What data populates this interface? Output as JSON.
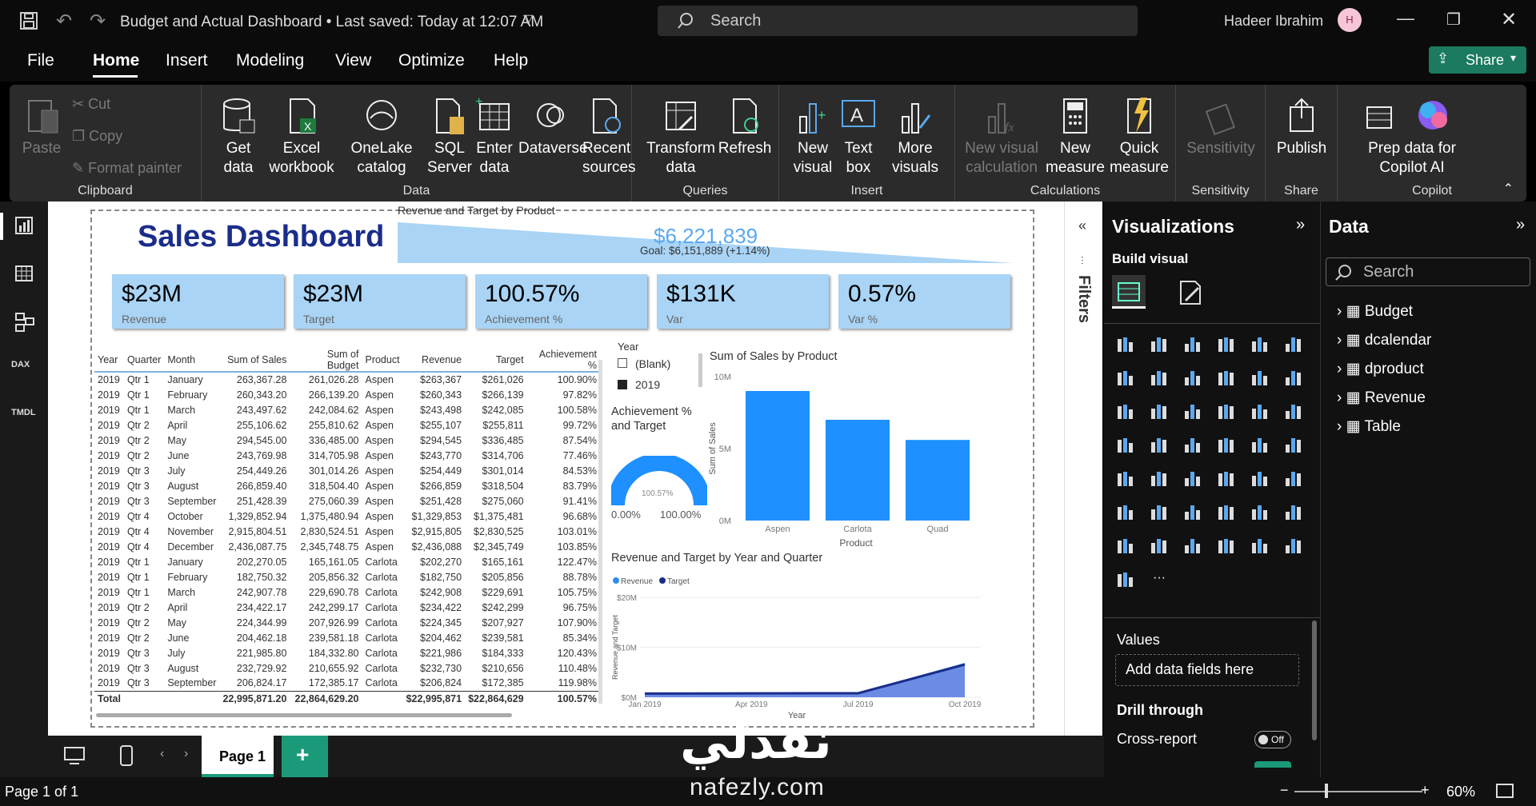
{
  "titlebar": {
    "file_title": "Budget and Actual Dashboard • Last saved: Today at 12:07 AM",
    "search": "Search",
    "user": "Hadeer Ibrahim",
    "avatar": "H"
  },
  "menu": {
    "items": [
      "File",
      "Home",
      "Insert",
      "Modeling",
      "View",
      "Optimize",
      "Help"
    ],
    "active": "Home",
    "share": "Share"
  },
  "ribbon": {
    "clipboard": {
      "paste": "Paste",
      "cut": "Cut",
      "copy": "Copy",
      "format_painter": "Format painter",
      "label": "Clipboard"
    },
    "data": {
      "get_data": "Get data",
      "excel": "Excel workbook",
      "onelake": "OneLake catalog",
      "sql": "SQL Server",
      "enter": "Enter data",
      "dataverse": "Dataverse",
      "recent": "Recent sources",
      "label": "Data"
    },
    "queries": {
      "transform": "Transform data",
      "refresh": "Refresh",
      "label": "Queries"
    },
    "insert": {
      "new_visual": "New visual",
      "text_box": "Text box",
      "more_visuals": "More visuals",
      "label": "Insert"
    },
    "calculations": {
      "new_visual_calc": "New visual calculation",
      "new_measure": "New measure",
      "quick_measure": "Quick measure",
      "label": "Calculations"
    },
    "sensitivity": {
      "btn": "Sensitivity",
      "label": "Sensitivity"
    },
    "share": {
      "publish": "Publish",
      "label": "Share"
    },
    "copilot": {
      "prep": "Prep data for Copilot AI",
      "label": "Copilot"
    }
  },
  "report": {
    "title": "Sales Dashboard",
    "gauge_title": "Revenue and Target by Product",
    "gauge_value": "$6,221,839",
    "gauge_goal": "Goal: $6,151,889 (+1.14%)",
    "kpis": [
      {
        "value": "$23M",
        "label": "Revenue"
      },
      {
        "value": "$23M",
        "label": "Target"
      },
      {
        "value": "100.57%",
        "label": "Achievement %"
      },
      {
        "value": "$131K",
        "label": "Var"
      },
      {
        "value": "0.57%",
        "label": "Var %"
      }
    ],
    "table": {
      "headers": [
        "Year",
        "Quarter",
        "Month",
        "Sum of Sales",
        "Sum of Budget",
        "Product",
        "Revenue",
        "Target",
        "Achievement %"
      ],
      "rows": [
        [
          "2019",
          "Qtr 1",
          "January",
          "263,367.28",
          "261,026.28",
          "Aspen",
          "$263,367",
          "$261,026",
          "100.90%"
        ],
        [
          "2019",
          "Qtr 1",
          "February",
          "260,343.20",
          "266,139.20",
          "Aspen",
          "$260,343",
          "$266,139",
          "97.82%"
        ],
        [
          "2019",
          "Qtr 1",
          "March",
          "243,497.62",
          "242,084.62",
          "Aspen",
          "$243,498",
          "$242,085",
          "100.58%"
        ],
        [
          "2019",
          "Qtr 2",
          "April",
          "255,106.62",
          "255,810.62",
          "Aspen",
          "$255,107",
          "$255,811",
          "99.72%"
        ],
        [
          "2019",
          "Qtr 2",
          "May",
          "294,545.00",
          "336,485.00",
          "Aspen",
          "$294,545",
          "$336,485",
          "87.54%"
        ],
        [
          "2019",
          "Qtr 2",
          "June",
          "243,769.98",
          "314,705.98",
          "Aspen",
          "$243,770",
          "$314,706",
          "77.46%"
        ],
        [
          "2019",
          "Qtr 3",
          "July",
          "254,449.26",
          "301,014.26",
          "Aspen",
          "$254,449",
          "$301,014",
          "84.53%"
        ],
        [
          "2019",
          "Qtr 3",
          "August",
          "266,859.40",
          "318,504.40",
          "Aspen",
          "$266,859",
          "$318,504",
          "83.79%"
        ],
        [
          "2019",
          "Qtr 3",
          "September",
          "251,428.39",
          "275,060.39",
          "Aspen",
          "$251,428",
          "$275,060",
          "91.41%"
        ],
        [
          "2019",
          "Qtr 4",
          "October",
          "1,329,852.94",
          "1,375,480.94",
          "Aspen",
          "$1,329,853",
          "$1,375,481",
          "96.68%"
        ],
        [
          "2019",
          "Qtr 4",
          "November",
          "2,915,804.51",
          "2,830,524.51",
          "Aspen",
          "$2,915,805",
          "$2,830,525",
          "103.01%"
        ],
        [
          "2019",
          "Qtr 4",
          "December",
          "2,436,087.75",
          "2,345,748.75",
          "Aspen",
          "$2,436,088",
          "$2,345,749",
          "103.85%"
        ],
        [
          "2019",
          "Qtr 1",
          "January",
          "202,270.05",
          "165,161.05",
          "Carlota",
          "$202,270",
          "$165,161",
          "122.47%"
        ],
        [
          "2019",
          "Qtr 1",
          "February",
          "182,750.32",
          "205,856.32",
          "Carlota",
          "$182,750",
          "$205,856",
          "88.78%"
        ],
        [
          "2019",
          "Qtr 1",
          "March",
          "242,907.78",
          "229,690.78",
          "Carlota",
          "$242,908",
          "$229,691",
          "105.75%"
        ],
        [
          "2019",
          "Qtr 2",
          "April",
          "234,422.17",
          "242,299.17",
          "Carlota",
          "$234,422",
          "$242,299",
          "96.75%"
        ],
        [
          "2019",
          "Qtr 2",
          "May",
          "224,344.99",
          "207,926.99",
          "Carlota",
          "$224,345",
          "$207,927",
          "107.90%"
        ],
        [
          "2019",
          "Qtr 2",
          "June",
          "204,462.18",
          "239,581.18",
          "Carlota",
          "$204,462",
          "$239,581",
          "85.34%"
        ],
        [
          "2019",
          "Qtr 3",
          "July",
          "221,985.80",
          "184,332.80",
          "Carlota",
          "$221,986",
          "$184,333",
          "120.43%"
        ],
        [
          "2019",
          "Qtr 3",
          "August",
          "232,729.92",
          "210,655.92",
          "Carlota",
          "$232,730",
          "$210,656",
          "110.48%"
        ],
        [
          "2019",
          "Qtr 3",
          "September",
          "206,824.17",
          "172,385.17",
          "Carlota",
          "$206,824",
          "$172,385",
          "119.98%"
        ]
      ],
      "total": [
        "Total",
        "",
        "",
        "22,995,871.20",
        "22,864,629.20",
        "",
        "$22,995,871",
        "$22,864,629",
        "100.57%"
      ]
    },
    "slicer": {
      "title": "Year",
      "items": [
        "(Blank)",
        "2019"
      ]
    },
    "donut": {
      "title": "Achievement % and Target",
      "value": "100.57%",
      "min": "0.00%",
      "max": "100.00%"
    },
    "bar_title": "Sum of Sales by Product",
    "area_title": "Revenue and Target by Year and Quarter"
  },
  "chart_data": [
    {
      "type": "bar",
      "title": "Sum of Sales by Product",
      "categories": [
        "Aspen",
        "Carlota",
        "Quad"
      ],
      "values": [
        9.0,
        7.0,
        5.6
      ],
      "ylabel": "Sum of Sales",
      "xlabel": "Product",
      "yticks": [
        "0M",
        "5M",
        "10M"
      ],
      "ylim": [
        0,
        10
      ]
    },
    {
      "type": "area",
      "title": "Revenue and Target by Year and Quarter",
      "x": [
        "Jan 2019",
        "Apr 2019",
        "Jul 2019",
        "Oct 2019"
      ],
      "series": [
        {
          "name": "Revenue",
          "values": [
            0.75,
            0.75,
            0.8,
            6.7
          ]
        },
        {
          "name": "Target",
          "values": [
            0.75,
            0.78,
            0.8,
            6.55
          ]
        }
      ],
      "xlabel": "Year",
      "ylabel": "Revenue and Target",
      "yticks": [
        "$0M",
        "$10M",
        "$20M"
      ],
      "ylim": [
        0,
        20
      ],
      "legend": "top-left",
      "colors": {
        "Revenue": "#2e8ef0",
        "Target": "#1a2d8a"
      }
    }
  ],
  "left_nav": [
    "report-view",
    "table-view",
    "model-view",
    "DAX",
    "TMDL"
  ],
  "filters_label": "Filters",
  "viz_pane": {
    "title": "Visualizations",
    "build": "Build visual",
    "values": "Values",
    "add": "Add data fields here",
    "drill": "Drill through",
    "cross": "Cross-report",
    "off": "Off"
  },
  "data_pane": {
    "title": "Data",
    "search": "Search",
    "tables": [
      "Budget",
      "dcalendar",
      "dproduct",
      "Revenue",
      "Table"
    ]
  },
  "pages": {
    "current": "Page 1"
  },
  "status": {
    "page": "Page 1 of 1",
    "zoom": "60%"
  },
  "watermark": {
    "arabic": "نفذلي",
    "url": "nafezly.com"
  }
}
